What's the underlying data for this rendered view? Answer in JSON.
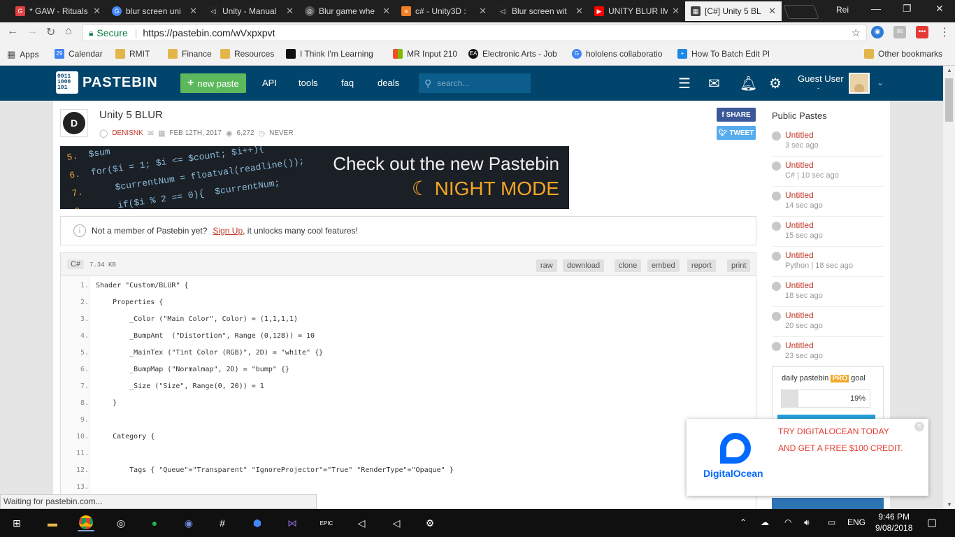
{
  "tabs": [
    {
      "title": "* GAW - Rituals",
      "color": "#e04040",
      "glyph": "G"
    },
    {
      "title": "blur screen uni",
      "color": "#4285f4",
      "glyph": "G"
    },
    {
      "title": "Unity - Manual",
      "color": "#222222",
      "glyph": "◁"
    },
    {
      "title": "Blur game whe",
      "color": "#555555",
      "glyph": "◎"
    },
    {
      "title": "c# - Unity3D :",
      "color": "#f48024",
      "glyph": "≡"
    },
    {
      "title": "Blur screen wit",
      "color": "#222222",
      "glyph": "◁"
    },
    {
      "title": "UNITY BLUR IM",
      "color": "#ff0000",
      "glyph": "▶"
    },
    {
      "title": "[C#] Unity 5 BL",
      "color": "#444444",
      "glyph": "▦"
    }
  ],
  "profile": "Rei",
  "toolbar": {
    "secure": "Secure",
    "url": "https://pastebin.com/wVxpxpvt"
  },
  "bookmarks": [
    {
      "label": "Apps",
      "color": "#777777"
    },
    {
      "label": "Calendar",
      "color": "#4285f4",
      "glyph": "29"
    },
    {
      "label": "RMIT",
      "color": "#e2b64a"
    },
    {
      "label": "Finance",
      "color": "#e2b64a"
    },
    {
      "label": "Resources",
      "color": "#e2b64a"
    },
    {
      "label": "I Think I'm Learning",
      "color": "#111111"
    },
    {
      "label": "MR Input 210",
      "color": "#f25022"
    },
    {
      "label": "Electronic Arts - Job",
      "color": "#111111",
      "glyph": "EA"
    },
    {
      "label": "hololens collaboratio",
      "color": "#4285f4",
      "glyph": "G"
    },
    {
      "label": "How To Batch Edit Pl",
      "color": "#1e88e5",
      "glyph": "+"
    },
    {
      "label": "Other bookmarks",
      "color": "#e2b64a"
    }
  ],
  "header": {
    "logo_text": "PASTEBIN",
    "logo_bits": "0011 1000 101",
    "new_paste": "new paste",
    "links": [
      "API",
      "tools",
      "faq",
      "deals"
    ],
    "search_placeholder": "search...",
    "guest_user": "Guest User",
    "guest_sub": "-"
  },
  "paste": {
    "title": "Unity 5 BLUR",
    "author": "DENISNK",
    "date": "FEB 12TH, 2017",
    "views": "6,272",
    "expires": "NEVER",
    "share": "SHARE",
    "tweet": "TWEET",
    "language": "C#",
    "size": "7.34 KB",
    "actions": [
      "raw",
      "download",
      "clone",
      "embed",
      "report",
      "print"
    ]
  },
  "banner": {
    "line1": "Check out the new Pastebin",
    "line2": "NIGHT MODE"
  },
  "notice": {
    "prefix": "Not a member of Pastebin yet?",
    "link": "Sign Up",
    "suffix": ", it unlocks many cool features!"
  },
  "code_lines": [
    {
      "n": "1.",
      "text": "Shader \"Custom/BLUR\" {"
    },
    {
      "n": "2.",
      "text": "    Properties {"
    },
    {
      "n": "3.",
      "text": "        _Color (\"Main Color\", Color) = (1,1,1,1)"
    },
    {
      "n": "4.",
      "text": "        _BumpAmt  (\"Distortion\", Range (0,128)) = 10"
    },
    {
      "n": "5.",
      "text": "        _MainTex (\"Tint Color (RGB)\", 2D) = \"white\" {}"
    },
    {
      "n": "6.",
      "text": "        _BumpMap (\"Normalmap\", 2D) = \"bump\" {}"
    },
    {
      "n": "7.",
      "text": "        _Size (\"Size\", Range(0, 20)) = 1"
    },
    {
      "n": "8.",
      "text": "    }"
    },
    {
      "n": "9.",
      "text": ""
    },
    {
      "n": "10.",
      "text": "    Category {"
    },
    {
      "n": "11.",
      "text": ""
    },
    {
      "n": "12.",
      "text": "        Tags { \"Queue\"=\"Transparent\" \"IgnoreProjector\"=\"True\" \"RenderType\"=\"Opaque\" }"
    },
    {
      "n": "13.",
      "text": ""
    }
  ],
  "sidebar": {
    "heading": "Public Pastes",
    "pastes": [
      {
        "title": "Untitled",
        "sub": "3 sec ago"
      },
      {
        "title": "Untitled",
        "sub": "C# | 10 sec ago"
      },
      {
        "title": "Untitled",
        "sub": "14 sec ago"
      },
      {
        "title": "Untitled",
        "sub": "15 sec ago"
      },
      {
        "title": "Untitled",
        "sub": "Python | 18 sec ago"
      },
      {
        "title": "Untitled",
        "sub": "18 sec ago"
      },
      {
        "title": "Untitled",
        "sub": "20 sec ago"
      },
      {
        "title": "Untitled",
        "sub": "23 sec ago"
      }
    ],
    "goal_label_pre": "daily pastebin",
    "goal_pro": "PRO",
    "goal_label_post": "goal",
    "goal_percent": "19%",
    "goal_fraction": 0.19
  },
  "ad": {
    "line1": "TRY DIGITALOCEAN TODAY",
    "line2": "AND GET A FREE $100 CREDIT.",
    "brand": "DigitalOcean"
  },
  "status": "Waiting for pastebin.com...",
  "taskbar": {
    "lang": "ENG",
    "time": "9:46 PM",
    "date": "9/08/2018"
  },
  "colors": {
    "pastebin_blue": "#02456c",
    "new_paste_green": "#5cb85c",
    "link_red": "#c0392b",
    "night_mode_orange": "#f5a623"
  }
}
